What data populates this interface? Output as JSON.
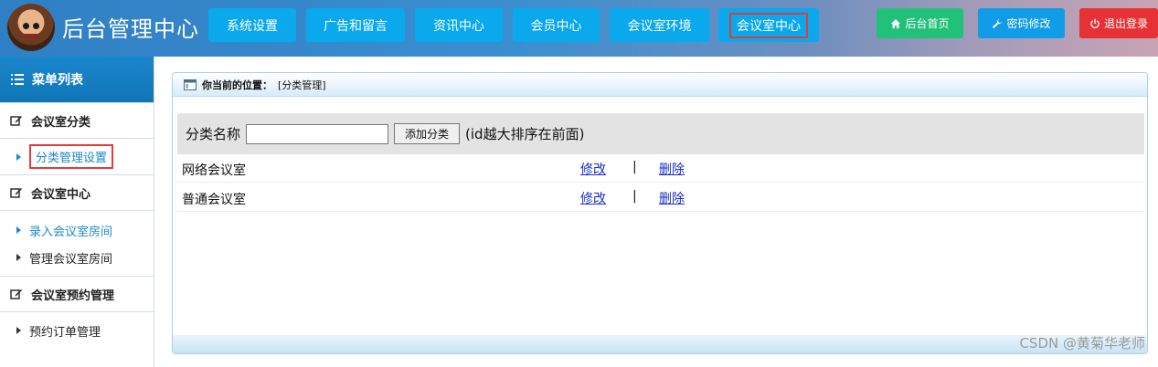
{
  "header": {
    "title": "后台管理中心",
    "nav": [
      {
        "label": "系统设置"
      },
      {
        "label": "广告和留言"
      },
      {
        "label": "资讯中心"
      },
      {
        "label": "会员中心"
      },
      {
        "label": "会议室环境"
      },
      {
        "label": "会议室中心"
      }
    ],
    "tools": {
      "home": "后台首页",
      "password": "密码修改",
      "logout": "退出登录"
    }
  },
  "sidebar": {
    "head": "菜单列表",
    "groups": [
      {
        "label": "会议室分类",
        "items": [
          "分类管理设置"
        ]
      },
      {
        "label": "会议室中心",
        "items": [
          "录入会议室房间",
          "管理会议室房间"
        ]
      },
      {
        "label": "会议室预约管理",
        "items": [
          "预约订单管理"
        ]
      }
    ]
  },
  "main": {
    "location_label": "你当前的位置：",
    "location_value": "[分类管理]",
    "form": {
      "label": "分类名称",
      "input_value": "",
      "add_button": "添加分类",
      "hint": "(id越大排序在前面)"
    },
    "categories": [
      {
        "name": "网络会议室",
        "edit": "修改",
        "sep": "|",
        "delete": "删除"
      },
      {
        "name": "普通会议室",
        "edit": "修改",
        "sep": "|",
        "delete": "删除"
      }
    ]
  },
  "watermark": "CSDN @黄菊华老师",
  "colors": {
    "accent": "#0aa8ec",
    "highlight": "#e23b3b",
    "link": "#1b2ec9"
  }
}
